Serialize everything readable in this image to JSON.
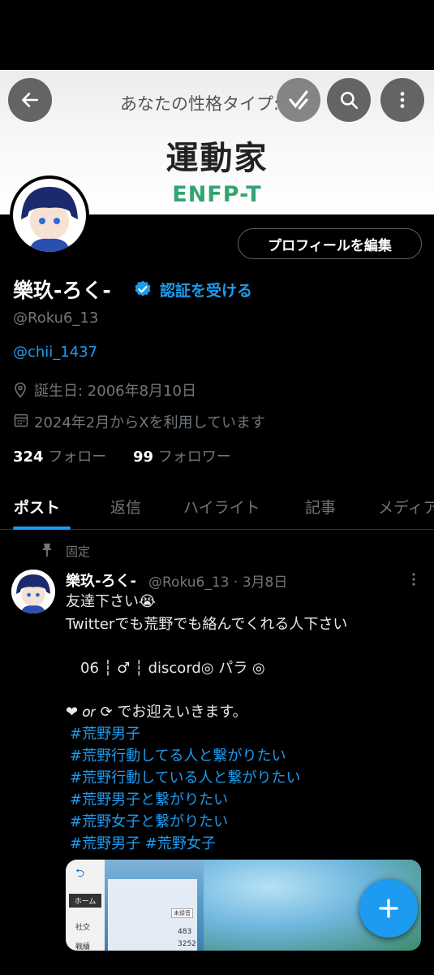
{
  "banner": {
    "label": "あなたの性格タイプ:",
    "type_name": "運動家",
    "type_code": "ENFP-T",
    "code_color": "#33a474"
  },
  "toolbar": {
    "back_icon": "arrow-left-icon",
    "grok_icon": "grok-icon",
    "search_icon": "search-icon",
    "more_icon": "more-vertical-icon"
  },
  "profile": {
    "edit_label": "プロフィールを編集",
    "name": "樂玖-ろく-",
    "verify_label": "認証を受ける",
    "handle": "@Roku6_13",
    "bio_link": "@chii_1437",
    "birthday": "誕生日: 2006年8月10日",
    "joined": "2024年2月からXを利用しています",
    "following_count": "324",
    "following_label": "フォロー",
    "followers_count": "99",
    "followers_label": "フォロワー",
    "accent": "#1d9bf0"
  },
  "tabs": [
    "ポスト",
    "返信",
    "ハイライト",
    "記事",
    "メディア"
  ],
  "post": {
    "pinned_label": "固定",
    "author": "樂玖-ろく-",
    "meta": "@Roku6_13 · 3月8日",
    "lines": [
      "友達下さい😭",
      "Twitterでも荒野でも絡んでくれる人下さい",
      "　06 ┆ ♂ ┆ discord◎ パラ ◎",
      "❤︎ 𝑜𝑟 ⟳ でお迎えいきます。"
    ],
    "hashtags": [
      "#荒野男子",
      "#荒野行動してる人と繋がりたい",
      "#荒野行動している人と繋がりたい",
      "#荒野男子と繋がりたい",
      "#荒野女子と繋がりたい",
      "#荒野男子 #荒野女子"
    ]
  },
  "media": {
    "menu_items": [
      "ホーム",
      "社交",
      "戦績"
    ],
    "stat_values": [
      "483",
      "3252"
    ],
    "badge": "未録音"
  },
  "fab_icon": "plus-icon"
}
